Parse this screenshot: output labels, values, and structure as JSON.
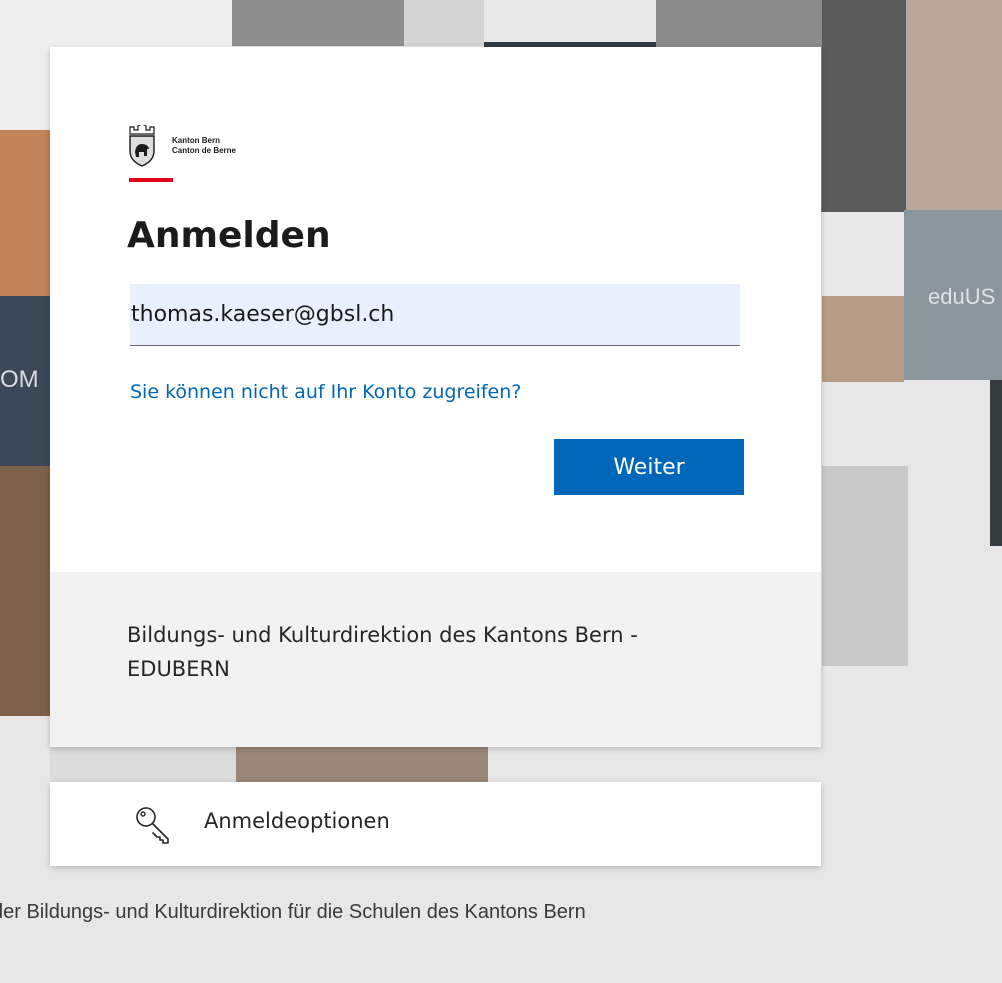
{
  "background": {
    "tile_text_left": "OM",
    "tile_text_right": "eduUS",
    "footer_text": "der Bildungs- und Kulturdirektion für die Schulen des Kantons Bern"
  },
  "logo": {
    "line1": "Kanton Bern",
    "line2": "Canton de Berne",
    "icon": "bern-coat-of-arms"
  },
  "login": {
    "title": "Anmelden",
    "email_value": "thomas.kaeser@gbsl.ch",
    "cant_access_link": "Sie können nicht auf Ihr Konto zugreifen?",
    "next_button": "Weiter"
  },
  "organization": {
    "name": "Bildungs- und Kulturdirektion des Kantons Bern - EDUBERN"
  },
  "options": {
    "label": "Anmeldeoptionen",
    "icon": "key-icon"
  },
  "colors": {
    "accent": "#0067b8",
    "brand_red": "#e2001a",
    "input_background": "#e8f0fe"
  }
}
